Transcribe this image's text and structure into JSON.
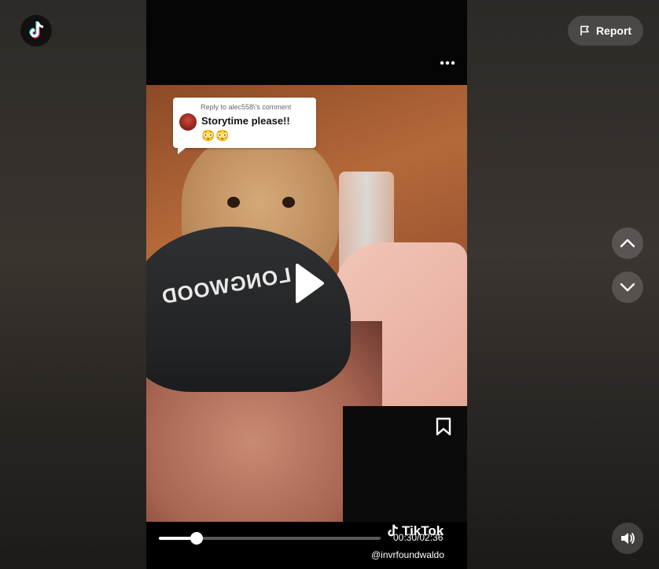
{
  "app": {
    "logo_icon": "tiktok-logo-icon"
  },
  "header": {
    "report_label": "Report",
    "report_icon": "flag-icon"
  },
  "video": {
    "comment_reply": {
      "reply_to": "Reply to alec558\\'s comment",
      "text": "Storytime please!!",
      "emojis": [
        "😳",
        "😳"
      ]
    },
    "cap_text": "LONGWOOD",
    "watermark_brand": "TikTok",
    "username": "@invrfoundwaldo",
    "time": "00:30/02:36",
    "progress": 0.17,
    "more_icon": "ellipsis-icon",
    "bookmark_icon": "bookmark-icon",
    "play_icon": "play-icon"
  },
  "controls": {
    "up_icon": "chevron-up-icon",
    "down_icon": "chevron-down-icon",
    "volume_icon": "volume-icon"
  },
  "colors": {
    "accent_cyan": "#25f4ee",
    "accent_red": "#fe2c55"
  }
}
